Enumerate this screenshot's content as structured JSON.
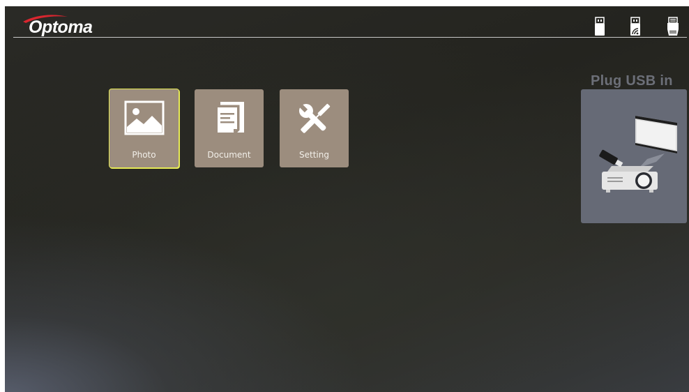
{
  "header": {
    "brand": "Optoma",
    "brand_color": "#d8262f",
    "device_icons": [
      {
        "name": "usb-drive-icon",
        "interactable": true
      },
      {
        "name": "wireless-usb-icon",
        "interactable": true
      },
      {
        "name": "usb-reader-icon",
        "interactable": true
      }
    ]
  },
  "menu": {
    "tiles": [
      {
        "label": "Photo",
        "icon": "photo-icon",
        "selected": true
      },
      {
        "label": "Document",
        "icon": "document-icon",
        "selected": false
      },
      {
        "label": "Setting",
        "icon": "tools-icon",
        "selected": false
      }
    ],
    "tile_color": "#9c8d7e",
    "selection_color": "#e6ea55"
  },
  "status_panel": {
    "title": "Plug USB in",
    "illustration": "usb-projector-illustration"
  }
}
